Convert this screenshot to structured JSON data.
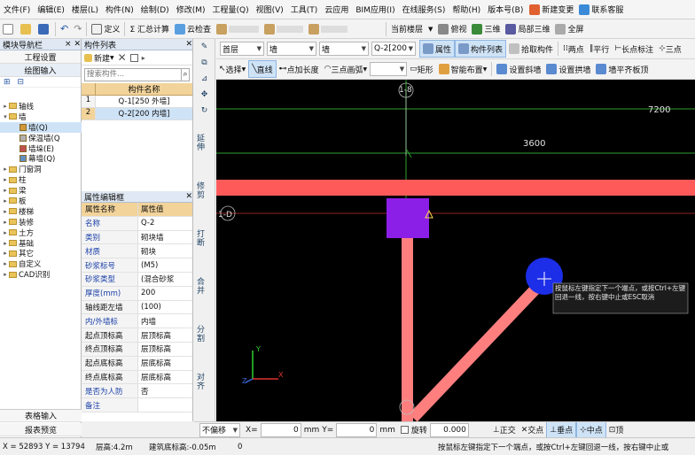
{
  "menubar": {
    "items": [
      "文件(F)",
      "编辑(E)",
      "楼层(L)",
      "构件(N)",
      "绘制(D)",
      "修改(M)",
      "工程量(Q)",
      "视图(V)",
      "工具(T)",
      "云应用",
      "BIM应用(I)",
      "在线服务(S)",
      "帮助(H)",
      "版本号(B)"
    ],
    "right": {
      "newchange": "新建变更",
      "service": "联系客服"
    }
  },
  "toolbar1": {
    "define": "定义",
    "calc": "Σ 汇总计算",
    "cloud_check": "云检查",
    "floor_label": "当前楼层",
    "view": "俯视",
    "render": "三维",
    "local3d": "局部三维",
    "fullscreen": "全屏"
  },
  "toolbar2": {
    "floor": "首层",
    "cat": "墙",
    "subcat": "墙",
    "comp": "Q-2[200",
    "attr": "属性",
    "complist": "构件列表",
    "pick": "拾取构件",
    "two_points": "两点",
    "parallel": "平行",
    "extend": "长点标注",
    "three": "三点"
  },
  "toolbar3": {
    "select": "选择",
    "line": "直线",
    "point_len": "点加长度",
    "arc": "三点画弧",
    "rect": "矩形",
    "smart": "智能布置",
    "set_slope": "设置斜墙",
    "set_arch": "设置拱墙",
    "flat": "墙平齐板顶"
  },
  "left_nav": {
    "title": "模块导航栏",
    "btn_settings": "工程设置",
    "btn_draw": "绘图输入",
    "tree": [
      {
        "label": "轴线",
        "level": 0,
        "type": "folder",
        "exp": "+"
      },
      {
        "label": "墙",
        "level": 0,
        "type": "folder",
        "exp": "-"
      },
      {
        "label": "墙(Q)",
        "level": 1,
        "type": "leaf",
        "color": "#d09838",
        "sel": true
      },
      {
        "label": "保温墙(Q",
        "level": 1,
        "type": "leaf",
        "color": "#b0b0b0"
      },
      {
        "label": "墙垛(E)",
        "level": 1,
        "type": "leaf",
        "color": "#c05050"
      },
      {
        "label": "幕墙(Q)",
        "level": 1,
        "type": "leaf",
        "color": "#6090c0"
      },
      {
        "label": "门窗洞",
        "level": 0,
        "type": "folder",
        "exp": "+"
      },
      {
        "label": "柱",
        "level": 0,
        "type": "folder",
        "exp": "+"
      },
      {
        "label": "梁",
        "level": 0,
        "type": "folder",
        "exp": "+"
      },
      {
        "label": "板",
        "level": 0,
        "type": "folder",
        "exp": "+"
      },
      {
        "label": "楼梯",
        "level": 0,
        "type": "folder",
        "exp": "+"
      },
      {
        "label": "装修",
        "level": 0,
        "type": "folder",
        "exp": "+"
      },
      {
        "label": "土方",
        "level": 0,
        "type": "folder",
        "exp": "+"
      },
      {
        "label": "基础",
        "level": 0,
        "type": "folder",
        "exp": "+"
      },
      {
        "label": "其它",
        "level": 0,
        "type": "folder",
        "exp": "+"
      },
      {
        "label": "自定义",
        "level": 0,
        "type": "folder",
        "exp": "+"
      },
      {
        "label": "CAD识别",
        "level": 0,
        "type": "folder",
        "exp": "+"
      }
    ],
    "bottom1": "表格输入",
    "bottom2": "报表预览"
  },
  "comp_list": {
    "title": "构件列表",
    "new": "新建",
    "search_placeholder": "搜索构件...",
    "col": "构件名称",
    "rows": [
      {
        "no": "1",
        "name": "Q-1[250 外墙]"
      },
      {
        "no": "2",
        "name": "Q-2[200 内墙]"
      }
    ]
  },
  "props": {
    "title": "属性编辑框",
    "col_name": "属性名称",
    "col_val": "属性值",
    "rows": [
      {
        "n": "名称",
        "v": "Q-2",
        "blue": true
      },
      {
        "n": "类别",
        "v": "砌块墙",
        "blue": true
      },
      {
        "n": "材质",
        "v": "砌块",
        "blue": true
      },
      {
        "n": "砂浆标号",
        "v": "(M5)",
        "blue": true
      },
      {
        "n": "砂浆类型",
        "v": "(混合砂浆",
        "blue": true
      },
      {
        "n": "厚度(mm)",
        "v": "200",
        "blue": true
      },
      {
        "n": "轴线距左墙",
        "v": "(100)",
        "blue": false
      },
      {
        "n": "内/外墙标",
        "v": "内墙",
        "blue": true
      },
      {
        "n": "起点顶标高",
        "v": "层顶标高",
        "blue": false
      },
      {
        "n": "终点顶标高",
        "v": "层顶标高",
        "blue": false
      },
      {
        "n": "起点底标高",
        "v": "层底标高",
        "blue": false
      },
      {
        "n": "终点底标高",
        "v": "层底标高",
        "blue": false
      },
      {
        "n": "是否为人防",
        "v": "否",
        "blue": true
      },
      {
        "n": "备注",
        "v": "",
        "blue": true
      }
    ]
  },
  "vtools": [
    "延伸",
    "修剪",
    "打断",
    "合并",
    "分割",
    "对齐"
  ],
  "canvas": {
    "axis_a": "1-8",
    "axis_b": "1-D",
    "dim1": "7200",
    "dim2": "3600",
    "tooltip": "按鼠标左键指定下一个端点，或按Ctrl+左键回退一线，按右键中止或ESC取消"
  },
  "bottombar": {
    "nooffset": "不偏移",
    "x_label": "X=",
    "x_val": "0",
    "mm1": "mm",
    "y_label": "Y=",
    "y_val": "0",
    "mm2": "mm",
    "rotate": "旋转",
    "rot_val": "0.000",
    "ortho": "正交",
    "intersect": "交点",
    "snap_mid": "垂点",
    "mid": "中点",
    "top": "顶"
  },
  "status": {
    "coords": "X = 52893  Y = 13794",
    "floor_h": "层高:4.2m",
    "base": "建筑底标高:-0.05m",
    "n": "0",
    "hint": "按鼠标左键指定下一个端点，或按Ctrl+左键回退一线，按右键中止或"
  }
}
